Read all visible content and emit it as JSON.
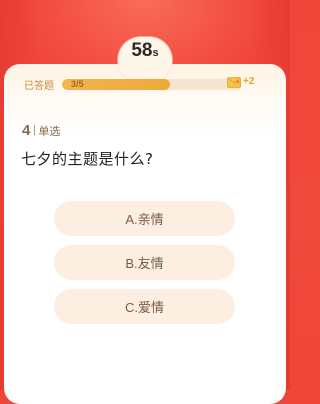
{
  "timer": {
    "value": "58",
    "unit": "s"
  },
  "progress": {
    "label": "已答题",
    "current": 3,
    "total": 5,
    "text": "3/5",
    "fraction": 0.6
  },
  "reward": {
    "icon": "envelope-heart-icon",
    "text": "+2"
  },
  "question": {
    "number": "4",
    "type": "单选",
    "text": "七夕的主题是什么?"
  },
  "options": [
    {
      "label": "A.亲情"
    },
    {
      "label": "B.友情"
    },
    {
      "label": "C.爱情"
    }
  ],
  "colors": {
    "background": "#f0463a",
    "accent": "#f0a83a",
    "option_bg": "#fdeee2"
  }
}
